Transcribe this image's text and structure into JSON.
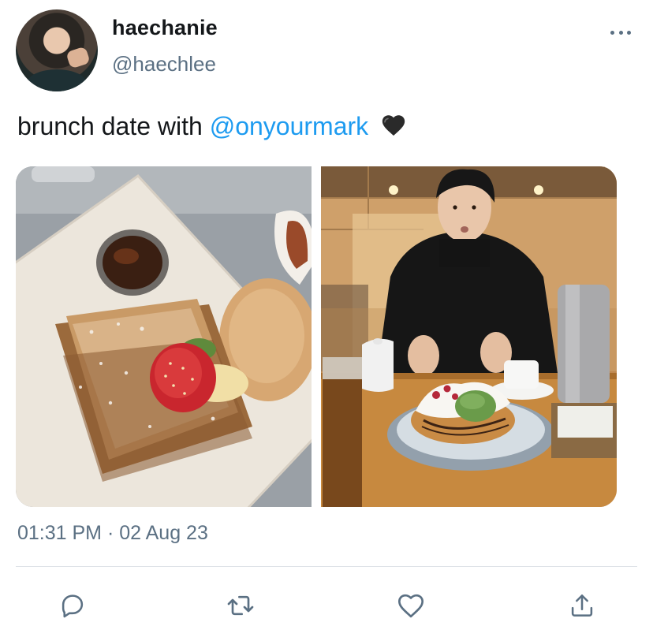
{
  "author": {
    "display_name": "haechanie",
    "handle": "@haechlee"
  },
  "tweet": {
    "text_prefix": "brunch date with ",
    "mention": "@onyourmark",
    "emoji": "black-heart"
  },
  "media": [
    {
      "subject": "french-toast-plate"
    },
    {
      "subject": "person-with-waffle"
    }
  ],
  "meta": {
    "time": "01:31 PM",
    "separator": "·",
    "date": "02 Aug 23"
  },
  "actions": [
    "reply-icon",
    "retweet-icon",
    "like-icon",
    "share-icon"
  ],
  "colors": {
    "accent": "#1d9bf0",
    "secondary_text": "#5b7083",
    "icon": "#5b7083"
  }
}
